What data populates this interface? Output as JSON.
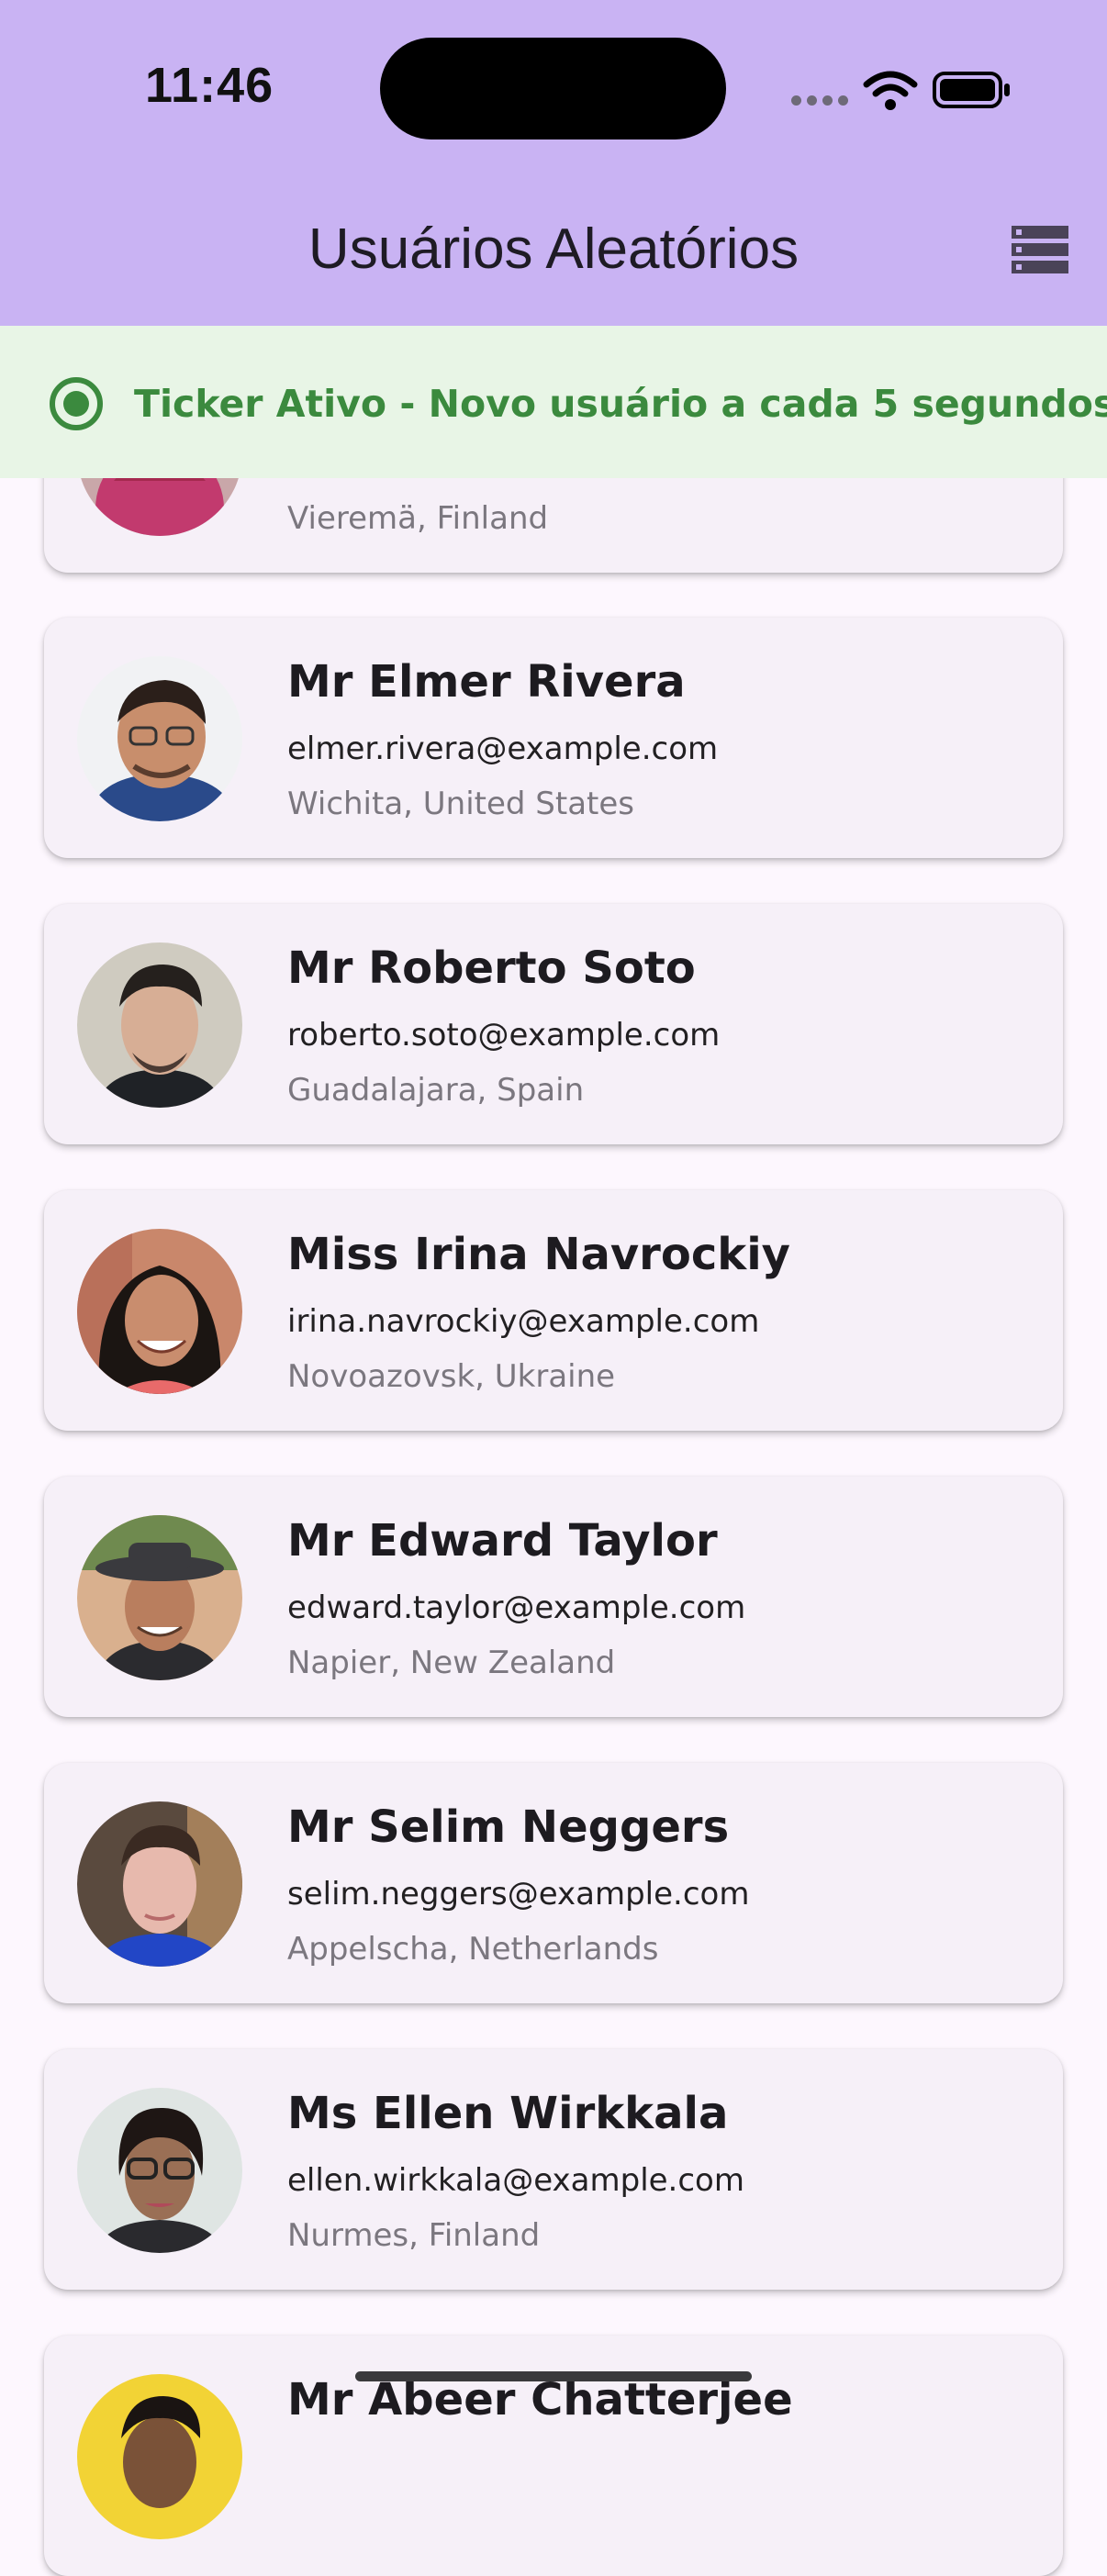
{
  "status_bar": {
    "time": "11:46",
    "icons": [
      "cellular-signal-icon",
      "wifi-icon",
      "battery-icon"
    ]
  },
  "app_bar": {
    "title": "Usuários Aleatórios",
    "menu_icon": "storage-icon",
    "background": "#c9b3f3"
  },
  "banner": {
    "text": "Ticker Ativo - Novo usuário a cada 5 segundos",
    "icon": "radio-button-checked-icon",
    "color": "#3b8a3e",
    "background": "#e8f5e6"
  },
  "users": [
    {
      "name": "",
      "email": "",
      "location": "Vieremä, Finland"
    },
    {
      "name": "Mr Elmer Rivera",
      "email": "elmer.rivera@example.com",
      "location": "Wichita, United States"
    },
    {
      "name": "Mr Roberto Soto",
      "email": "roberto.soto@example.com",
      "location": "Guadalajara, Spain"
    },
    {
      "name": "Miss Irina Navrockiy",
      "email": "irina.navrockiy@example.com",
      "location": "Novoazovsk, Ukraine"
    },
    {
      "name": "Mr Edward Taylor",
      "email": "edward.taylor@example.com",
      "location": "Napier, New Zealand"
    },
    {
      "name": "Mr Selim Neggers",
      "email": "selim.neggers@example.com",
      "location": "Appelscha, Netherlands"
    },
    {
      "name": "Ms Ellen Wirkkala",
      "email": "ellen.wirkkala@example.com",
      "location": "Nurmes, Finland"
    },
    {
      "name": "Mr Abeer Chatterjee",
      "email": "",
      "location": ""
    }
  ]
}
